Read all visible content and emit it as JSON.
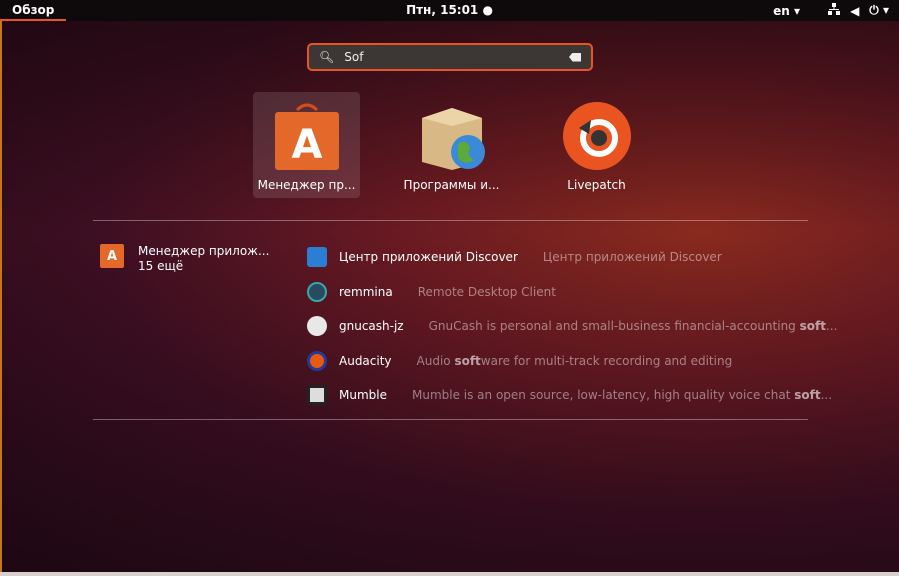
{
  "topbar": {
    "activities": "Обзор",
    "clock": "Птн, 15:01 ●",
    "lang": "en ▾",
    "network_icon": "network-icon",
    "volume_icon": "volume-icon",
    "power": "⏻ ▾"
  },
  "search": {
    "value": "Sof"
  },
  "apps": [
    {
      "label": "Менеджер пр...",
      "icon": "software-center-icon"
    },
    {
      "label": "Программы и...",
      "icon": "software-properties-icon"
    },
    {
      "label": "Livepatch",
      "icon": "livepatch-icon"
    }
  ],
  "provider": {
    "name": "Менеджер прилож...",
    "more": "15 ещё"
  },
  "results": [
    {
      "name": "Центр приложений Discover",
      "pre": "Центр приложений Discover",
      "bold": "",
      "post": "",
      "icon": "discover-icon",
      "color": "#2a7fd4"
    },
    {
      "name": "remmina",
      "pre": "Remote Desktop Client",
      "bold": "",
      "post": "",
      "icon": "remmina-icon",
      "color": "#2a4a60"
    },
    {
      "name": "gnucash-jz",
      "pre": "GnuCash is personal and small-business financial-accounting ",
      "bold": "soft",
      "post": "...",
      "icon": "gnucash-icon",
      "color": "#e8e8e8"
    },
    {
      "name": "Audacity",
      "pre": "Audio ",
      "bold": "soft",
      "post": "ware for multi-track recording and editing",
      "icon": "audacity-icon",
      "color": "#e85a10"
    },
    {
      "name": "Mumble",
      "pre": "Mumble is an open source, low-latency, high quality voice chat ",
      "bold": "soft",
      "post": "...",
      "icon": "mumble-icon",
      "color": "#ddd"
    }
  ]
}
